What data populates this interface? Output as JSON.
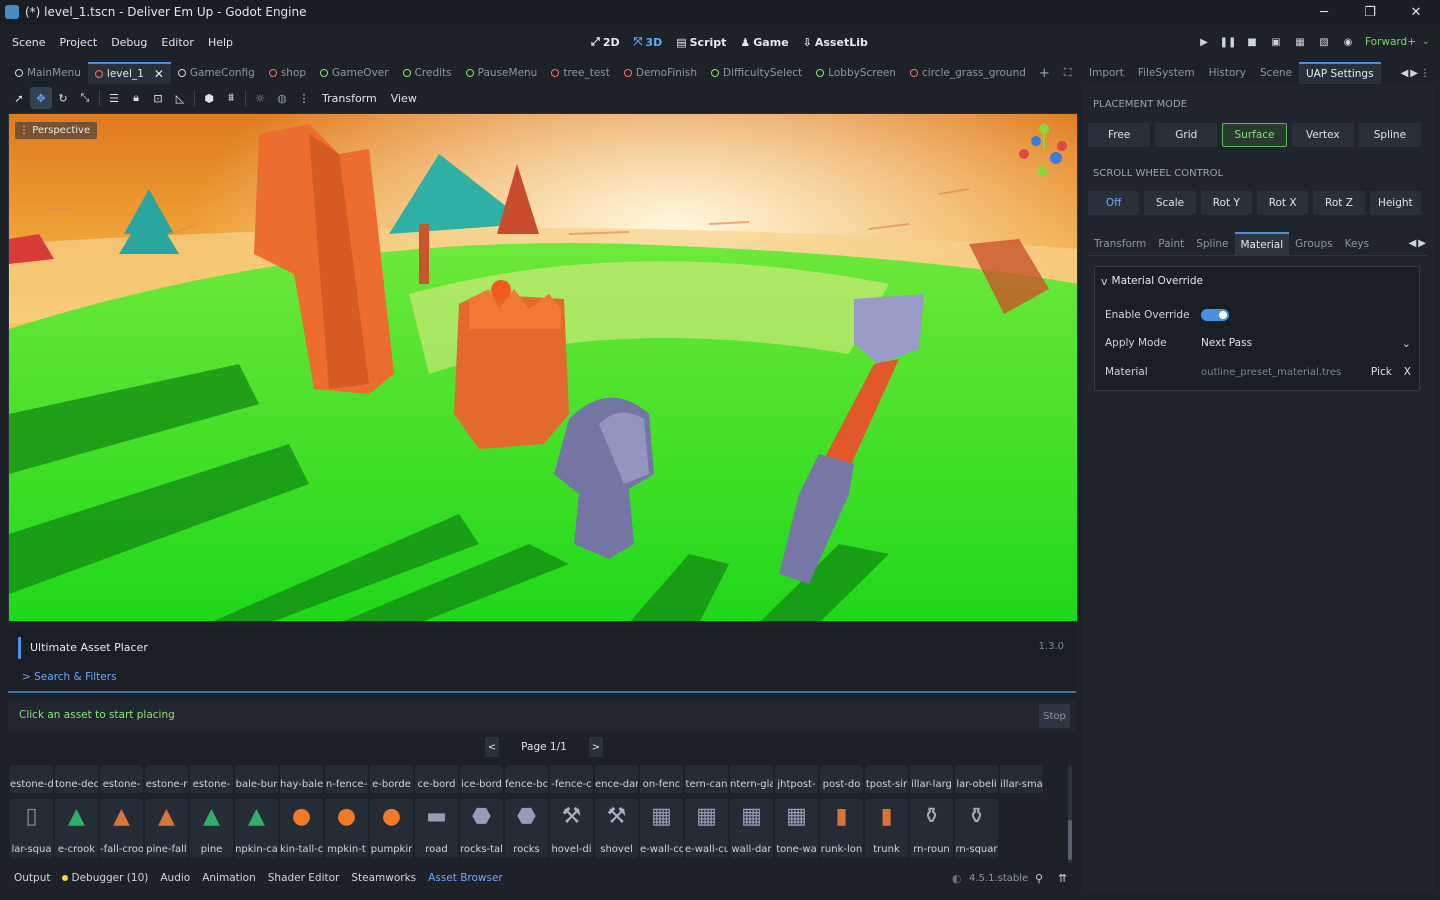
{
  "window": {
    "title": "(*) level_1.tscn - Deliver Em Up - Godot Engine",
    "minimize": "─",
    "maximize": "❐",
    "close": "✕"
  },
  "menu": [
    "Scene",
    "Project",
    "Debug",
    "Editor",
    "Help"
  ],
  "modes": [
    {
      "label": "2D",
      "icon": "2d-icon"
    },
    {
      "label": "3D",
      "icon": "3d-icon"
    },
    {
      "label": "Script",
      "icon": "script-icon"
    },
    {
      "label": "Game",
      "icon": "game-icon"
    },
    {
      "label": "AssetLib",
      "icon": "assetlib-icon"
    }
  ],
  "renderer": "Forward+",
  "scene_tabs": [
    "MainMenu",
    "level_1",
    "GameConfig",
    "shop",
    "GameOver",
    "Credits",
    "PauseMenu",
    "tree_test",
    "DemoFinish",
    "DifficultySelect",
    "LobbyScreen",
    "circle_grass_ground"
  ],
  "active_scene_tab": "level_1",
  "toolbar": {
    "transform": "Transform",
    "view": "View"
  },
  "viewport": {
    "perspective_label": "Perspective"
  },
  "uap": {
    "title": "Ultimate Asset Placer",
    "version": "1.3.0",
    "filters": "Search & Filters",
    "status": "Click an asset to start placing",
    "stop": "Stop",
    "page": "Page 1/1",
    "prev": "<",
    "next": ">"
  },
  "asset_row1": [
    "estone-d",
    "tone-dec",
    "estone-",
    "estone-r",
    "estone-",
    "bale-bur",
    "hay-bale",
    "n-fence-",
    "e-borde",
    "ce-bord",
    "ice-bord",
    "fence-bc",
    "-fence-c",
    "ence-dar",
    "on-fenc",
    "tern-can",
    "ntern-gla",
    "jhtpost-",
    "post-do",
    "tpost-sir",
    "illar-larg",
    "lar-obeli",
    "illar-sma"
  ],
  "asset_row2": [
    {
      "label": "lar-squa",
      "icon": "pillar-icon"
    },
    {
      "label": "e-crook",
      "icon": "pine-icon"
    },
    {
      "label": "-fall-croo",
      "icon": "pine-fall-icon"
    },
    {
      "label": "pine-fall",
      "icon": "pine-fall-icon"
    },
    {
      "label": "pine",
      "icon": "pine-icon"
    },
    {
      "label": "npkin-ca",
      "icon": "pine-icon"
    },
    {
      "label": "kin-tall-c",
      "icon": "pumpkin-icon"
    },
    {
      "label": "mpkin-t",
      "icon": "pumpkin-icon"
    },
    {
      "label": "pumpkir",
      "icon": "pumpkin-icon"
    },
    {
      "label": "road",
      "icon": "road-icon"
    },
    {
      "label": "rocks-tal",
      "icon": "rocks-icon"
    },
    {
      "label": "rocks",
      "icon": "rocks-icon"
    },
    {
      "label": "hovel-di",
      "icon": "shovel-icon"
    },
    {
      "label": "shovel",
      "icon": "shovel-icon"
    },
    {
      "label": "e-wall-co",
      "icon": "wall-icon"
    },
    {
      "label": "e-wall-cu",
      "icon": "wall-icon"
    },
    {
      "label": "wall-dar",
      "icon": "wall-icon"
    },
    {
      "label": "tone-wa",
      "icon": "wall-icon"
    },
    {
      "label": "runk-lon",
      "icon": "trunk-icon"
    },
    {
      "label": "trunk",
      "icon": "trunk-icon"
    },
    {
      "label": "rn-roun",
      "icon": "urn-icon"
    },
    {
      "label": "rn-squar",
      "icon": "urn-icon"
    }
  ],
  "bottom_tabs": [
    "Output",
    "Debugger (10)",
    "Audio",
    "Animation",
    "Shader Editor",
    "Steamworks",
    "Asset Browser"
  ],
  "active_bottom_tab": "Asset Browser",
  "engine_version": "4.5.1.stable",
  "right_tabs": [
    "Import",
    "FileSystem",
    "History",
    "Scene",
    "UAP Settings"
  ],
  "active_right_tab": "UAP Settings",
  "placement": {
    "label": "PLACEMENT MODE",
    "options": [
      "Free",
      "Grid",
      "Surface",
      "Vertex",
      "Spline"
    ],
    "selected": "Surface"
  },
  "scroll": {
    "label": "SCROLL WHEEL CONTROL",
    "options": [
      "Off",
      "Scale",
      "Rot Y",
      "Rot X",
      "Rot Z",
      "Height"
    ],
    "selected": "Off"
  },
  "sub_tabs": [
    "Transform",
    "Paint",
    "Spline",
    "Material",
    "Groups",
    "Keys"
  ],
  "active_sub_tab": "Material",
  "material_override": {
    "header": "Material Override",
    "enable_label": "Enable Override",
    "enabled": true,
    "apply_label": "Apply Mode",
    "apply_value": "Next Pass",
    "material_label": "Material",
    "material_value": "outline_preset_material.tres",
    "pick": "Pick",
    "clear": "X"
  },
  "colors": {
    "accent": "#4f8fe0",
    "selected_green": "#7fe07d",
    "status_text": "#8ee07c"
  }
}
